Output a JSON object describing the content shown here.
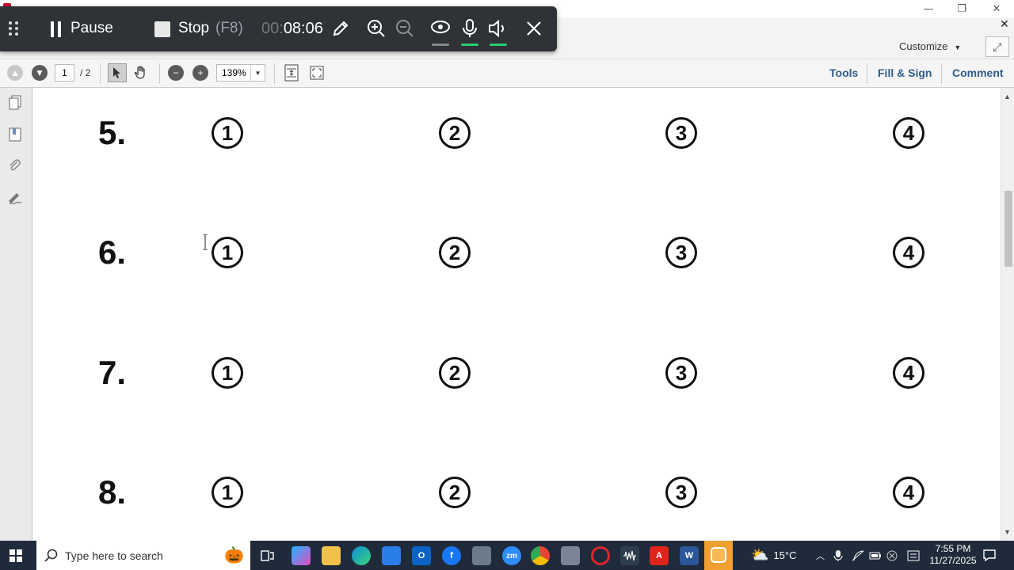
{
  "window": {
    "minimize": "—",
    "restore": "❐",
    "close": "✕"
  },
  "menu": {
    "customize_label": "Customize",
    "close_doc": "✕"
  },
  "toolbar": {
    "page_current": "1",
    "page_total": "/ 2",
    "zoom": "139%",
    "tools_label": "Tools",
    "fill_sign_label": "Fill & Sign",
    "comment_label": "Comment"
  },
  "recorder": {
    "pause_label": "Pause",
    "stop_label": "Stop",
    "stop_key": "(F8)",
    "timer_dim": "00:",
    "timer": "08:06"
  },
  "document": {
    "rows": [
      {
        "num": "5.",
        "options": [
          "1",
          "2",
          "3",
          "4"
        ]
      },
      {
        "num": "6.",
        "options": [
          "1",
          "2",
          "3",
          "4"
        ]
      },
      {
        "num": "7.",
        "options": [
          "1",
          "2",
          "3",
          "4"
        ]
      },
      {
        "num": "8.",
        "options": [
          "1",
          "2",
          "3",
          "4"
        ]
      }
    ]
  },
  "taskbar": {
    "search_placeholder": "Type here to search",
    "weather": "15°C",
    "time": "7:55 PM",
    "date": "11/27/2025",
    "apps": [
      "task-view",
      "copilot",
      "file-explorer",
      "edge",
      "store",
      "outlook",
      "facebook",
      "remote-app",
      "zoom",
      "chrome",
      "file-manager",
      "opera",
      "audio-editor",
      "acrobat",
      "word",
      "recorder"
    ]
  },
  "colors": {
    "accent": "#2e5d8c",
    "recorder_bg": "#2f3237",
    "taskbar_bg": "#1f2a3a",
    "level_green": "#2ecc71"
  }
}
